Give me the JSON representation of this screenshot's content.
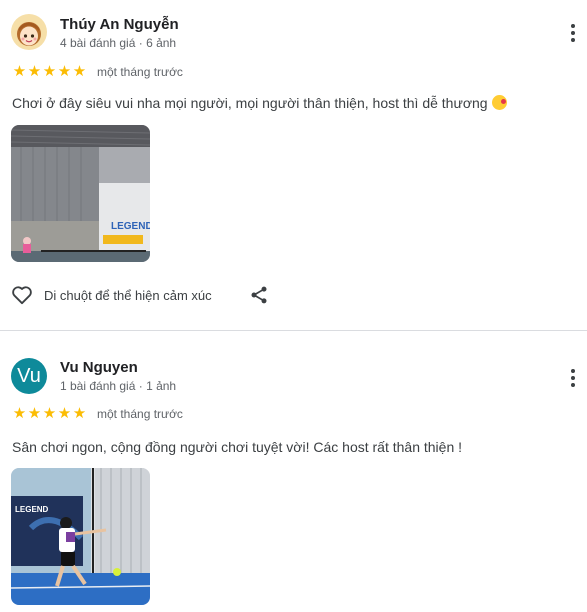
{
  "reviews": [
    {
      "author": "Thúy An Nguyễn",
      "meta": "4 bài đánh giá · 6 ảnh",
      "rating": 5,
      "date": "một tháng trước",
      "text": "Chơi ở đây siêu vui nha mọi người, mọi người thân thiện, host thì dễ thương",
      "emoji": "face-blowing-kiss",
      "react_label": "Di chuột để thể hiện cảm xúc",
      "photo_sign_text": "LEGEND"
    },
    {
      "author": "Vu Nguyen",
      "avatar_initials": "Vu",
      "meta": "1 bài đánh giá · 1 ảnh",
      "rating": 5,
      "date": "một tháng trước",
      "text": "Sân chơi ngon, cộng đồng người chơi tuyệt vời! Các host rất thân thiện !",
      "photo_sign_text": "LEGEND"
    }
  ],
  "icons": {
    "more": "more-vert-icon",
    "star": "star-icon",
    "heart": "heart-outline-icon",
    "share": "share-icon"
  },
  "colors": {
    "star": "#fbbc04",
    "avatar_bg": "#0e8a9a",
    "divider": "#dadce0"
  }
}
